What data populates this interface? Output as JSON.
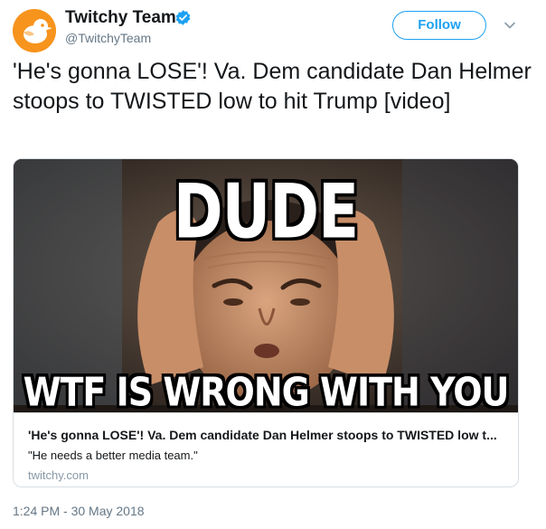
{
  "author": {
    "display_name": "Twitchy Team",
    "handle": "@TwitchyTeam",
    "verified": true,
    "avatar_icon": "bird-icon"
  },
  "follow_label": "Follow",
  "tweet_text": "'He's gonna LOSE'! Va. Dem candidate Dan Helmer stoops to TWISTED low to hit Trump [video]",
  "card": {
    "image_top_text": "DUDE",
    "image_bottom_text": "WTF IS WRONG WITH YOU",
    "title": "'He's gonna LOSE'! Va. Dem candidate Dan Helmer stoops to TWISTED low t...",
    "description": "\"He needs a better media team.\"",
    "domain": "twitchy.com"
  },
  "timestamp": "1:24 PM - 30 May 2018",
  "colors": {
    "accent": "#1da1f2",
    "avatar_bg": "#f7941d",
    "secondary_text": "#657786"
  }
}
